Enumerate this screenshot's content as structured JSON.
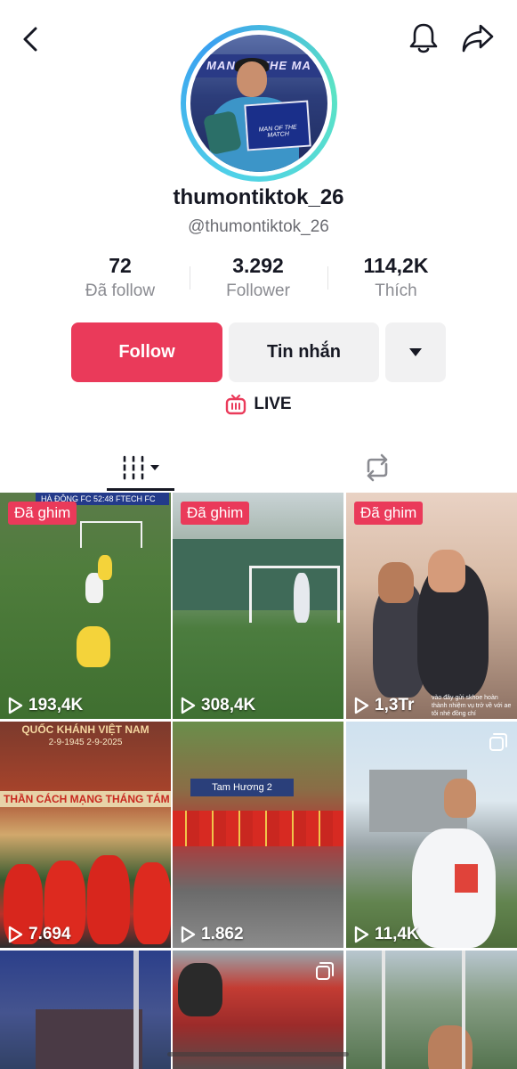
{
  "profile": {
    "username": "thumontiktok_26",
    "handle": "@thumontiktok_26",
    "avatar_banner": "MAN OF THE MA",
    "avatar_board": "MAN OF THE MATCH"
  },
  "stats": [
    {
      "value": "72",
      "label": "Đã follow"
    },
    {
      "value": "3.292",
      "label": "Follower"
    },
    {
      "value": "114,2K",
      "label": "Thích"
    }
  ],
  "actions": {
    "follow": "Follow",
    "message": "Tin nhắn"
  },
  "live": {
    "label": "LIVE"
  },
  "colors": {
    "accent": "#ea3a5a",
    "button_gray": "#f1f1f2",
    "text": "#161823",
    "secondary_text": "#8a8b91",
    "avatar_ring": "#4fd1e8"
  },
  "icons": {
    "back": "chevron-left-icon",
    "bell": "bell-icon",
    "share": "share-arrow-icon",
    "dropdown": "triangle-down-icon",
    "live": "tv-live-icon",
    "videos_tab": "grid-bars-icon",
    "repost_tab": "repost-icon",
    "play": "play-outline-icon",
    "multi": "carousel-icon"
  },
  "videos": [
    {
      "pinned": "Đã ghim",
      "views": "193,4K",
      "scoreboard": "HÀ ĐÔNG FC  52:48  FTECH FC"
    },
    {
      "pinned": "Đã ghim",
      "views": "308,4K"
    },
    {
      "pinned": "Đã ghim",
      "views": "1,3Tr",
      "caption": "vào đây gửi skhoe hoàn thành nhiệm vụ trở về với ae tôi nhé đồng chí"
    },
    {
      "views": "7.694",
      "headline": "QUỐC KHÁNH VIỆT NAM",
      "dates": "2-9-1945  2-9-2025",
      "banner": "THẦN CÁCH MẠNG THÁNG TÁM VÀ QUỐC"
    },
    {
      "views": "1.862",
      "sign": "Tam Hương 2"
    },
    {
      "views": "11,4K"
    },
    {},
    {},
    {}
  ]
}
